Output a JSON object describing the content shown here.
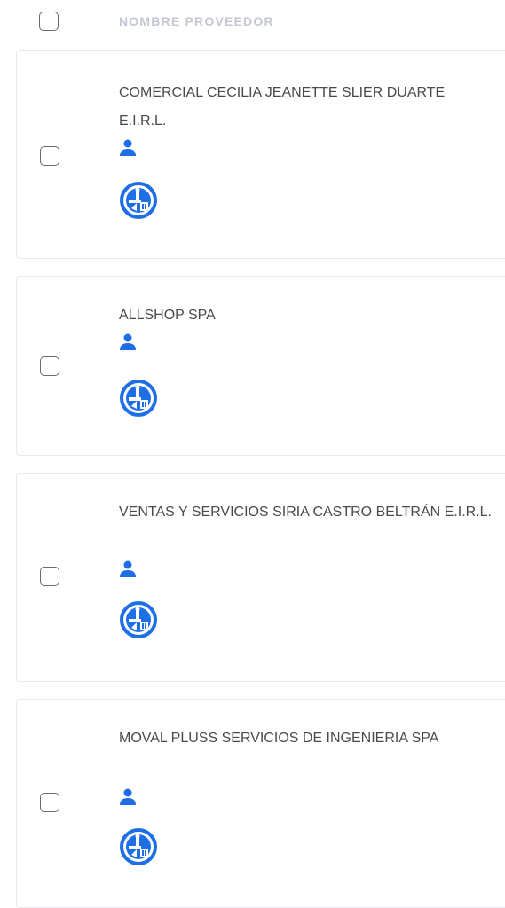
{
  "header": {
    "column_title": "NOMBRE PROVEEDOR"
  },
  "colors": {
    "icon_blue": "#1e6fe6",
    "header_text": "#c5c8d3",
    "row_text": "#4a4a4a",
    "row_border": "#e9e9ee"
  },
  "icons": {
    "person": "person-icon",
    "logo": "supplier-logo-icon"
  },
  "suppliers": [
    {
      "name": "COMERCIAL CECILIA JEANETTE SLIER DUARTE E.I.R.L."
    },
    {
      "name": "ALLSHOP SPA"
    },
    {
      "name": "VENTAS Y SERVICIOS SIRIA CASTRO BELTRÁN E.I.R.L."
    },
    {
      "name": "MOVAL PLUSS SERVICIOS DE INGENIERIA SPA"
    }
  ]
}
